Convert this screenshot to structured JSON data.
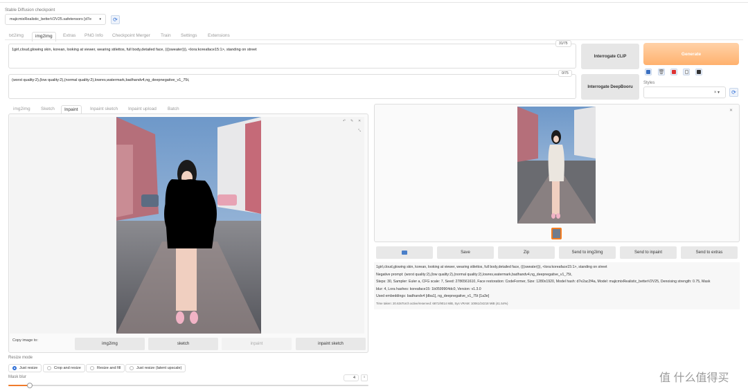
{
  "checkpoint": {
    "label": "Stable Diffusion checkpoint",
    "value": "majicmixRealistic_betterV2V25.safetensors [d7e"
  },
  "main_tabs": [
    "txt2img",
    "img2img",
    "Extras",
    "PNG Info",
    "Checkpoint Merger",
    "Train",
    "Settings",
    "Extensions"
  ],
  "prompt": {
    "positive": "1girl,cloud,glowing skin, korean, looking at viewer, wearing stilettos, full body,detailed face, (((sweater))), <lora:koreaface15:1>, standing on street",
    "positive_counter": "31/75",
    "negative": "(worst quality:2),(low quality:2),(normal quality:2),lowres,watermark,badhandv4,ng_deepnegative_v1_75t,",
    "negative_counter": "0/75"
  },
  "interrogate": {
    "clip": "Interrogate CLIP",
    "deepbooru": "Interrogate DeepBooru"
  },
  "generate_label": "Generate",
  "styles_label": "Styles",
  "style_select_value": "× ▾",
  "sub_tabs": [
    "img2img",
    "Sketch",
    "Inpaint",
    "Inpaint sketch",
    "Inpaint upload",
    "Batch"
  ],
  "copy_image": {
    "label": "Copy image to:",
    "buttons": [
      "img2img",
      "sketch",
      "inpaint",
      "inpaint sketch"
    ]
  },
  "resize": {
    "label": "Resize mode",
    "options": [
      "Just resize",
      "Crop and resize",
      "Resize and fill",
      "Just resize (latent upscale)"
    ],
    "selected": "Just resize"
  },
  "mask_blur": {
    "label": "Mask blur",
    "value": "4",
    "fraction": 0.06
  },
  "output_actions": [
    "Save",
    "Zip",
    "Send to img2img",
    "Send to inpaint",
    "Send to extras"
  ],
  "gen_info": {
    "line1": "1girl,cloud,glowing skin, korean, looking at viewer, wearing stilettos, full body,detailed face, (((sweater))), <lora:koreaface15:1>, standing on street",
    "line2": "Negative prompt: (worst quality:2),(low quality:2),(normal quality:2),lowres,watermark,badhandv4,ng_deepnegative_v1_75t,",
    "line3": "Steps: 30, Sampler: Euler a, CFG scale: 7, Seed: 2786561610, Face restoration: CodeFormer, Size: 1280x1920, Model hash: d7e2ac2f4a, Model: majicmixRealistic_betterV2V25, Denoising strength: 0.75, Mask",
    "line4": "blur: 4, Lora hashes: koreaface15: 1b0599904dc0, Version: v1.3.0",
    "line5": "Used embeddings: badhandv4 [dba1], ng_deepnegative_v1_75t [1a3e]",
    "timing": "Time taken: 20.63sTorch active/reserved: 6871/9014 MiB, Sys VRAM: 10061/24218 MiB (41.54%)"
  },
  "watermark": "值 什么值得买",
  "colors": {
    "generate_orange": "#ff9a3a",
    "accent_blue": "#2f6fd6",
    "thumb_selected": "#f57c1f"
  }
}
